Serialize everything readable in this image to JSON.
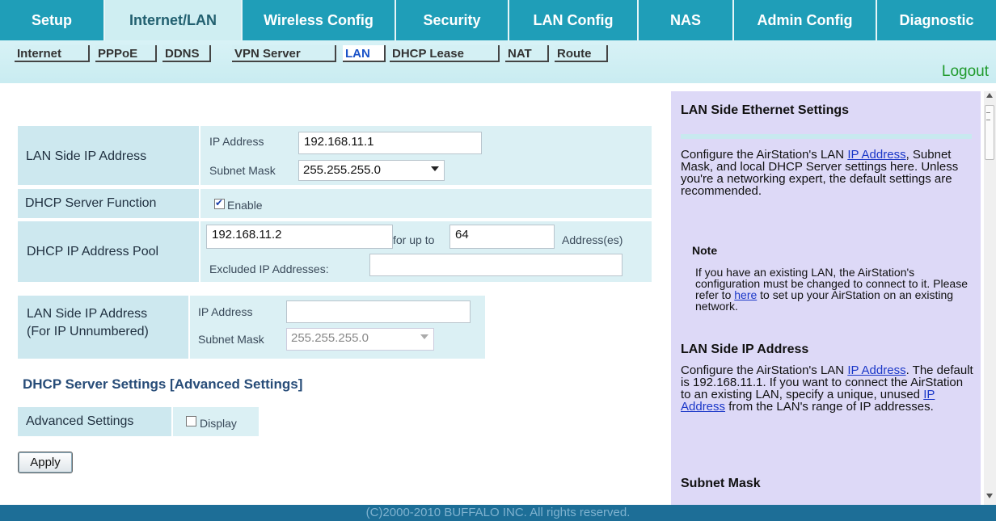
{
  "nav": {
    "tabs": [
      {
        "label": "Setup"
      },
      {
        "label": "Internet/LAN"
      },
      {
        "label": "Wireless Config"
      },
      {
        "label": "Security"
      },
      {
        "label": "LAN Config"
      },
      {
        "label": "NAS"
      },
      {
        "label": "Admin Config"
      },
      {
        "label": "Diagnostic"
      }
    ],
    "active_tab": "Internet/LAN",
    "subtabs": [
      {
        "label": "Internet"
      },
      {
        "label": "PPPoE"
      },
      {
        "label": "DDNS"
      },
      {
        "label": "VPN Server"
      },
      {
        "label": "LAN"
      },
      {
        "label": "DHCP Lease"
      },
      {
        "label": "NAT"
      },
      {
        "label": "Route"
      }
    ],
    "active_subtab": "LAN",
    "logout_label": "Logout"
  },
  "form": {
    "lan_ip": {
      "label": "LAN Side IP Address",
      "ip_label": "IP Address",
      "ip_value": "192.168.11.1",
      "mask_label": "Subnet Mask",
      "mask_value": "255.255.255.0"
    },
    "dhcp_server": {
      "label": "DHCP Server Function",
      "checkbox_label": "Enable",
      "checked": true
    },
    "dhcp_pool": {
      "label": "DHCP IP Address Pool",
      "start_value": "192.168.11.2",
      "for_up_to_label": "for up to",
      "count_value": "64",
      "addresses_label": "Address(es)",
      "excluded_label": "Excluded IP Addresses:",
      "excluded_value": ""
    },
    "unnumbered": {
      "label_line1": "LAN Side IP Address",
      "label_line2": "(For IP Unnumbered)",
      "ip_label": "IP Address",
      "ip_value": "",
      "mask_label": "Subnet Mask",
      "mask_value": "255.255.255.0"
    },
    "advanced_section_title": "DHCP Server Settings [Advanced Settings]",
    "advanced": {
      "label": "Advanced Settings",
      "checkbox_label": "Display",
      "checked": false
    },
    "apply_label": "Apply"
  },
  "help": {
    "title": "LAN Side Ethernet Settings",
    "intro": {
      "pre": "Configure the AirStation's LAN ",
      "link": "IP Address",
      "post": ", Subnet Mask, and local DHCP Server settings here. Unless you're a networking expert, the default settings are recommended."
    },
    "note_title": "Note",
    "note": {
      "pre": "If you have an existing LAN, the AirStation's configuration must be changed to connect to it. Please refer to ",
      "link": "here",
      "post": " to set up your AirStation on an existing network."
    },
    "lan_ip_title": "LAN Side IP Address",
    "lan_ip_text": {
      "pre": "Configure the AirStation's LAN ",
      "link1": "IP Address",
      "mid": ". The default is 192.168.11.1. If you want to connect the AirStation to an existing LAN, specify a unique, unused ",
      "link2": "IP Address",
      "post": " from the LAN's range of IP addresses."
    },
    "subnet_title": "Subnet Mask"
  },
  "footer": {
    "text": "(C)2000-2010 BUFFALO INC. All rights reserved."
  },
  "colors": {
    "tab_bg": "#1f9eb8",
    "tab_active_bg": "#cfeef2",
    "label_bg": "#cde8ef",
    "help_bg": "#ddd9f7",
    "footer_bg": "#1d6e97",
    "link": "#1a37c8",
    "logout": "#1f9a2c"
  }
}
